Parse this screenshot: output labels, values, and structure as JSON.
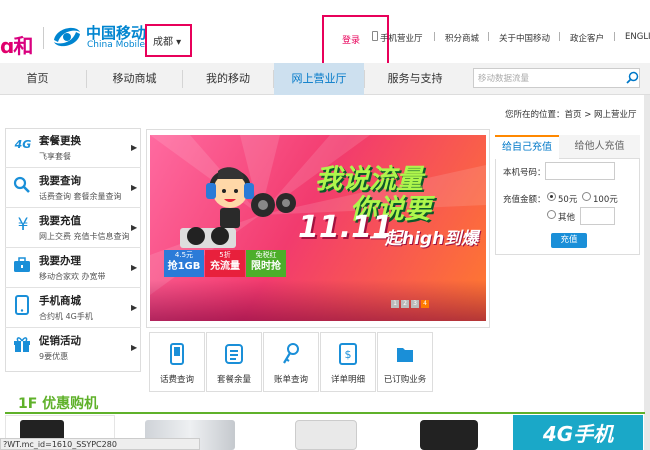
{
  "header": {
    "brand_he": "和",
    "brand_cn": "中国移动",
    "brand_en": "China Mobile",
    "city": "成都",
    "login": "登录",
    "top_links": [
      "手机营业厅",
      "积分商城",
      "关于中国移动",
      "政企客户",
      "ENGLI"
    ]
  },
  "nav": {
    "items": [
      "首页",
      "移动商城",
      "我的移动",
      "网上营业厅",
      "服务与支持"
    ],
    "active_index": 3,
    "search_placeholder": "移动数据流量"
  },
  "breadcrumb": "您所在的位置：首页 > 网上营业厅",
  "side_menu": [
    {
      "icon": "4g-icon",
      "title": "套餐更换",
      "sub": "飞享套餐"
    },
    {
      "icon": "search-icon",
      "title": "我要查询",
      "sub": "话费查询 套餐余量查询"
    },
    {
      "icon": "yen-icon",
      "title": "我要充值",
      "sub": "网上交费 充值卡信息查询"
    },
    {
      "icon": "briefcase-icon",
      "title": "我要办理",
      "sub": "移动合家欢 办宽带"
    },
    {
      "icon": "phone-icon",
      "title": "手机商城",
      "sub": "合约机 4G手机"
    },
    {
      "icon": "gift-icon",
      "title": "促销活动",
      "sub": "9要优惠"
    }
  ],
  "banner": {
    "line1": "我说流量",
    "line2": "你说要",
    "line3": "11.11",
    "line4": "一起high到爆",
    "boxes": [
      {
        "top": "4.5元",
        "main": "抢1GB",
        "color": "#2b7bd8"
      },
      {
        "top": "5折",
        "main": "充流量",
        "color": "#e8203c"
      },
      {
        "top": "免税红",
        "main": "限时抢",
        "color": "#4cae2a"
      }
    ],
    "dots": [
      "1",
      "2",
      "3",
      "4"
    ],
    "active_dot": 3
  },
  "quick_tiles": [
    {
      "icon": "phone-bill-icon",
      "label": "话费查询"
    },
    {
      "icon": "plan-balance-icon",
      "label": "套餐余量"
    },
    {
      "icon": "key-icon",
      "label": "账单查询"
    },
    {
      "icon": "detail-list-icon",
      "label": "详单明细"
    },
    {
      "icon": "folder-icon",
      "label": "已订购业务"
    }
  ],
  "recharge": {
    "tab_self": "给自己充值",
    "tab_other": "给他人充值",
    "phone_label": "本机号码：",
    "amount_label": "充值金额：",
    "options": [
      "50元",
      "100元",
      "其他"
    ],
    "selected": 0,
    "button": "充值"
  },
  "floor": {
    "title": "1F 优惠购机",
    "promo": "4G手机"
  },
  "status_bar": "?WT.mc_id=1610_SSYPC280",
  "colors": {
    "accent": "#0078c8",
    "highlight_box": "#e8005a",
    "floor_green": "#5fb12a"
  }
}
